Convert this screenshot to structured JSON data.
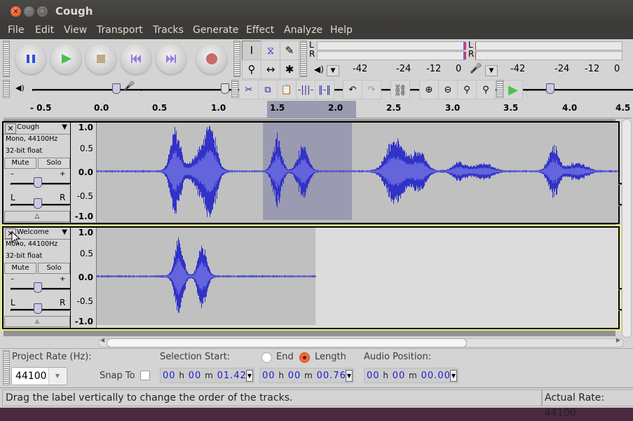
{
  "window": {
    "title": "Cough"
  },
  "menu": [
    "File",
    "Edit",
    "View",
    "Transport",
    "Tracks",
    "Generate",
    "Effect",
    "Analyze",
    "Help"
  ],
  "transport": {
    "buttons": [
      {
        "name": "pause",
        "icon": "pause-icon"
      },
      {
        "name": "play",
        "icon": "play-icon"
      },
      {
        "name": "stop",
        "icon": "stop-icon"
      },
      {
        "name": "skip-start",
        "icon": "skip-start-icon"
      },
      {
        "name": "skip-end",
        "icon": "skip-end-icon"
      },
      {
        "name": "record",
        "icon": "record-icon"
      }
    ]
  },
  "tools": [
    {
      "name": "selection-tool",
      "glyph": "I",
      "selected": true
    },
    {
      "name": "envelope-tool",
      "glyph": "⧖",
      "selected": false
    },
    {
      "name": "draw-tool",
      "glyph": "✎",
      "selected": false
    },
    {
      "name": "zoom-tool",
      "glyph": "⚲",
      "selected": false
    },
    {
      "name": "timeshift-tool",
      "glyph": "↔",
      "selected": false
    },
    {
      "name": "multi-tool",
      "glyph": "✱",
      "selected": false
    }
  ],
  "meters": {
    "playback": {
      "channels": [
        "L",
        "R"
      ],
      "scale": [
        "-42",
        "-24",
        "-12",
        "0"
      ]
    },
    "record": {
      "channels": [
        "L",
        "R"
      ],
      "scale": [
        "-42",
        "-24",
        "-12",
        "0"
      ]
    }
  },
  "mixer": {
    "output_volume": 1.0,
    "input_volume": 1.0
  },
  "edit_toolbar": [
    "cut",
    "copy",
    "paste",
    "trim",
    "silence",
    "undo",
    "redo",
    "sync-lock",
    "zoom-in",
    "zoom-out",
    "fit-selection",
    "fit-project"
  ],
  "play_at_speed": {
    "speed_fraction": 0.35
  },
  "ruler": {
    "ticks": [
      "- 0.5",
      "0.0",
      "0.5",
      "1.0",
      "1.5",
      "2.0",
      "2.5",
      "3.0",
      "3.5",
      "4.0",
      "4.5"
    ],
    "selection_start": 1.42,
    "selection_end": 2.18
  },
  "tracks": [
    {
      "name": "Cough",
      "format": "Mono, 44100Hz",
      "sample": "32-bit float",
      "mute": "Mute",
      "solo": "Solo",
      "gain": 0.5,
      "pan": 0.5,
      "scale": [
        "1.0",
        "0.5",
        "0.0",
        "-0.5",
        "-1.0"
      ],
      "duration_s": 4.47,
      "focused": false
    },
    {
      "name": "Welcome",
      "format": "Mono, 44100Hz",
      "sample": "32-bit float",
      "mute": "Mute",
      "solo": "Solo",
      "gain": 0.5,
      "pan": 0.5,
      "scale": [
        "1.0",
        "0.5",
        "0.0",
        "-0.5",
        "-1.0"
      ],
      "duration_s": 1.87,
      "focused": true
    }
  ],
  "selection_bar": {
    "project_rate_label": "Project Rate (Hz):",
    "project_rate": "44100",
    "snap_to_label": "Snap To",
    "snap_to": false,
    "selection_start_label": "Selection Start:",
    "end_label": "End",
    "length_label": "Length",
    "length_selected": true,
    "audio_position_label": "Audio Position:",
    "selection_start": {
      "h": "00",
      "m": "00",
      "s": "01.42"
    },
    "length": {
      "h": "00",
      "m": "00",
      "s": "00.76"
    },
    "audio_position": {
      "h": "00",
      "m": "00",
      "s": "00.00"
    }
  },
  "status": {
    "message": "Drag the label vertically to change the order of the tracks.",
    "actual_rate": "Actual Rate: 44100"
  },
  "colors": {
    "waveform": "#3232c8",
    "waveform_rms": "#6464dc",
    "selection": "#9a9ab0",
    "track_bg": "#c0c0c0"
  }
}
